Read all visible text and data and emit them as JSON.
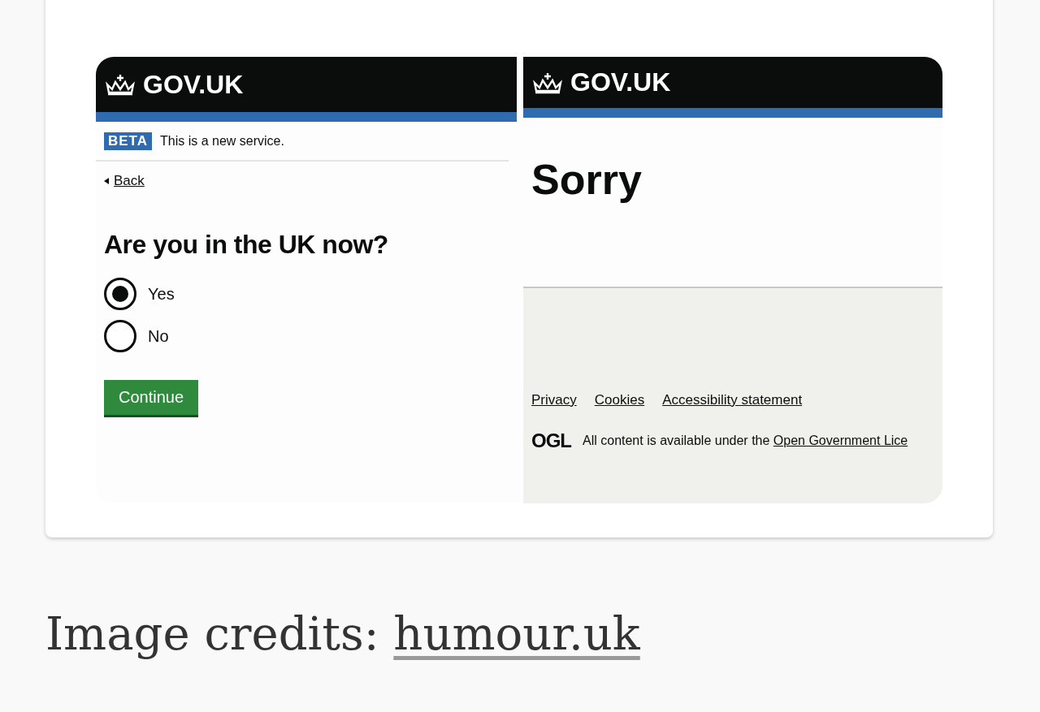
{
  "left_page": {
    "header": {
      "logo_text": "GOV.UK"
    },
    "phase_banner": {
      "tag": "BETA",
      "text": "This is a new service."
    },
    "back_link": "Back",
    "question": "Are you in the UK now?",
    "options": [
      {
        "label": "Yes",
        "selected": true
      },
      {
        "label": "No",
        "selected": false
      }
    ],
    "button": "Continue"
  },
  "right_page": {
    "header": {
      "logo_text": "GOV.UK"
    },
    "heading": "Sorry",
    "footer": {
      "links": [
        "Privacy",
        "Cookies",
        "Accessibility statement"
      ],
      "licence_logo": "OGL",
      "licence_text": "All content is available under the ",
      "licence_link": "Open Government Lice"
    }
  },
  "caption": {
    "text": "Image credits: ",
    "link": "humour.uk"
  }
}
